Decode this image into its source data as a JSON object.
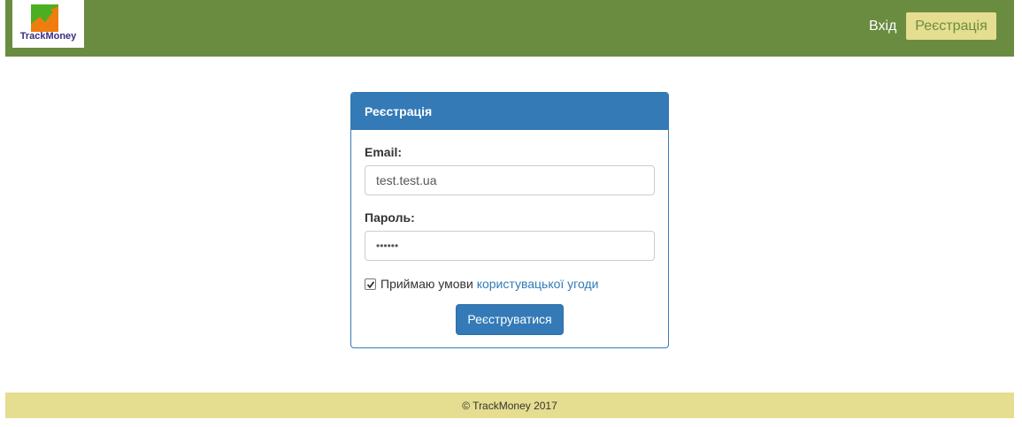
{
  "brand": {
    "logo_text": "TrackMoney",
    "colors": {
      "navbar": "#6a8c40",
      "accent": "#337ab7",
      "footer": "#e5dd8f"
    }
  },
  "nav": {
    "login_label": "Вхід",
    "register_label": "Реєстрація"
  },
  "form": {
    "title": "Реєстрація",
    "email_label": "Email:",
    "email_value": "test.test.ua",
    "password_label": "Пароль:",
    "password_value": "••••••",
    "agree_checked": true,
    "agree_text": "Приймаю умови",
    "agree_link": "користувацької угоди",
    "submit_label": "Реєструватися"
  },
  "footer": {
    "text": "© TrackMoney 2017"
  }
}
